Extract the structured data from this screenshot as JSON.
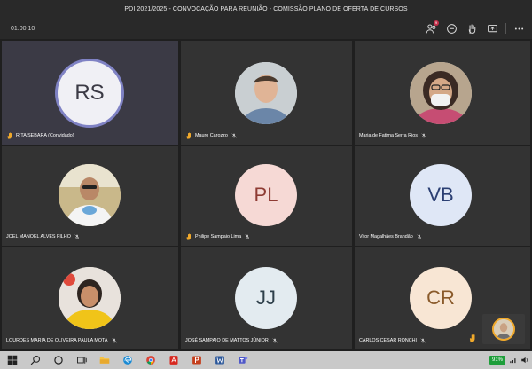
{
  "window": {
    "title": "PDI 2021/2025 - CONVOCAÇÃO PARA REUNIÃO - COMISSÃO PLANO DE OFERTA DE CURSOS"
  },
  "toolbar": {
    "timer": "01:00:10",
    "participants_badge": "9",
    "icons": [
      "participants-icon",
      "chat-icon",
      "raise-hand-icon",
      "share-screen-icon",
      "more-options-icon"
    ]
  },
  "participants": [
    {
      "name": "RITA SEBARA (Convidado)",
      "initials": "RS",
      "avatar_type": "initials",
      "avatar_bg": "#3b3a45",
      "initials_color": "#3b3a45",
      "ring": true,
      "hand_raised": true,
      "muted": false,
      "speaking": true
    },
    {
      "name": "Mauro Carozzo",
      "initials": "",
      "avatar_type": "photo",
      "hand_raised": true,
      "muted": true
    },
    {
      "name": "Maria de Fatima Serra Rios",
      "initials": "",
      "avatar_type": "photo",
      "hand_raised": false,
      "muted": true
    },
    {
      "name": "JOEL MANOEL ALVES FILHO",
      "initials": "",
      "avatar_type": "photo",
      "hand_raised": false,
      "muted": true
    },
    {
      "name": "Philipe Sampaio Lima",
      "initials": "PL",
      "avatar_type": "initials",
      "avatar_bg": "#f6d9d5",
      "initials_color": "#8e3b33",
      "hand_raised": true,
      "muted": true
    },
    {
      "name": "Vitor Magalhães Brandão",
      "initials": "VB",
      "avatar_type": "initials",
      "avatar_bg": "#dfe7f6",
      "initials_color": "#2b3f73",
      "hand_raised": false,
      "muted": true
    },
    {
      "name": "LOURDES MARIA DE OLIVEIRA PAULA MOTA",
      "initials": "",
      "avatar_type": "photo",
      "hand_raised": false,
      "muted": true
    },
    {
      "name": "JOSÉ SAMPAIO DE MATTOS JÚNIOR",
      "initials": "JJ",
      "avatar_type": "initials",
      "avatar_bg": "#e3ebf0",
      "initials_color": "#2e3f4a",
      "hand_raised": false,
      "muted": true
    },
    {
      "name": "CARLOS CESAR RONCHI",
      "initials": "CR",
      "avatar_type": "initials",
      "avatar_bg": "#f8e6d4",
      "initials_color": "#8a5a2a",
      "hand_raised": false,
      "muted": true
    }
  ],
  "taskbar": {
    "battery": "91%",
    "apps": [
      "windows-start-icon",
      "search-icon",
      "cortana-icon",
      "task-view-icon",
      "file-explorer-icon",
      "edge-icon",
      "chrome-icon",
      "acrobat-icon",
      "powerpoint-icon",
      "word-icon",
      "teams-icon"
    ]
  },
  "colors": {
    "accent": "#6264a7",
    "hand": "#f0a92b",
    "battery": "#1e9e3a"
  }
}
